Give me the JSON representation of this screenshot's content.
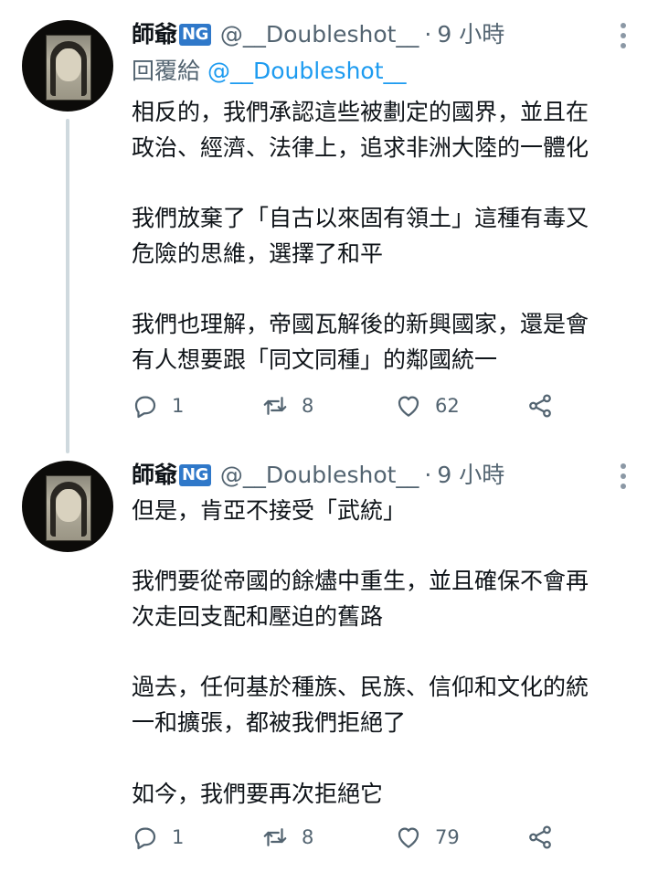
{
  "tweets": [
    {
      "author_name": "師爺",
      "badge": "NG",
      "handle": "@__Doubleshot__",
      "separator": "·",
      "time": "9 小時",
      "reply_prefix": "回覆給",
      "reply_handle": "@__Doubleshot__",
      "lines": [
        "相反的，我們承認這些被劃定的國界，並且在",
        "政治、經濟、法律上，追求非洲大陸的一體化",
        "",
        "我們放棄了「自古以來固有領土」這種有毒又",
        "危險的思維，選擇了和平",
        "",
        "我們也理解，帝國瓦解後的新興國家，還是會",
        "有人想要跟「同文同種」的鄰國統一"
      ],
      "replies": "1",
      "retweets": "8",
      "likes": "62"
    },
    {
      "author_name": "師爺",
      "badge": "NG",
      "handle": "@__Doubleshot__",
      "separator": "·",
      "time": "9 小時",
      "lines": [
        "但是，肯亞不接受「武統」",
        "",
        "我們要從帝國的餘燼中重生，並且確保不會再",
        "次走回支配和壓迫的舊路",
        "",
        "過去，任何基於種族、民族、信仰和文化的統",
        "一和擴張，都被我們拒絕了",
        "",
        "如今，我們要再次拒絕它"
      ],
      "replies": "1",
      "retweets": "8",
      "likes": "79"
    }
  ],
  "icons": {
    "reply": "reply-icon",
    "retweet": "retweet-icon",
    "like": "heart-icon",
    "share": "share-icon",
    "more": "more-vertical-icon"
  },
  "colors": {
    "text": "#0f1419",
    "secondary": "#536471",
    "link": "#1d9bf0",
    "badge": "#2f78c9",
    "thread_line": "#cfd9de"
  }
}
